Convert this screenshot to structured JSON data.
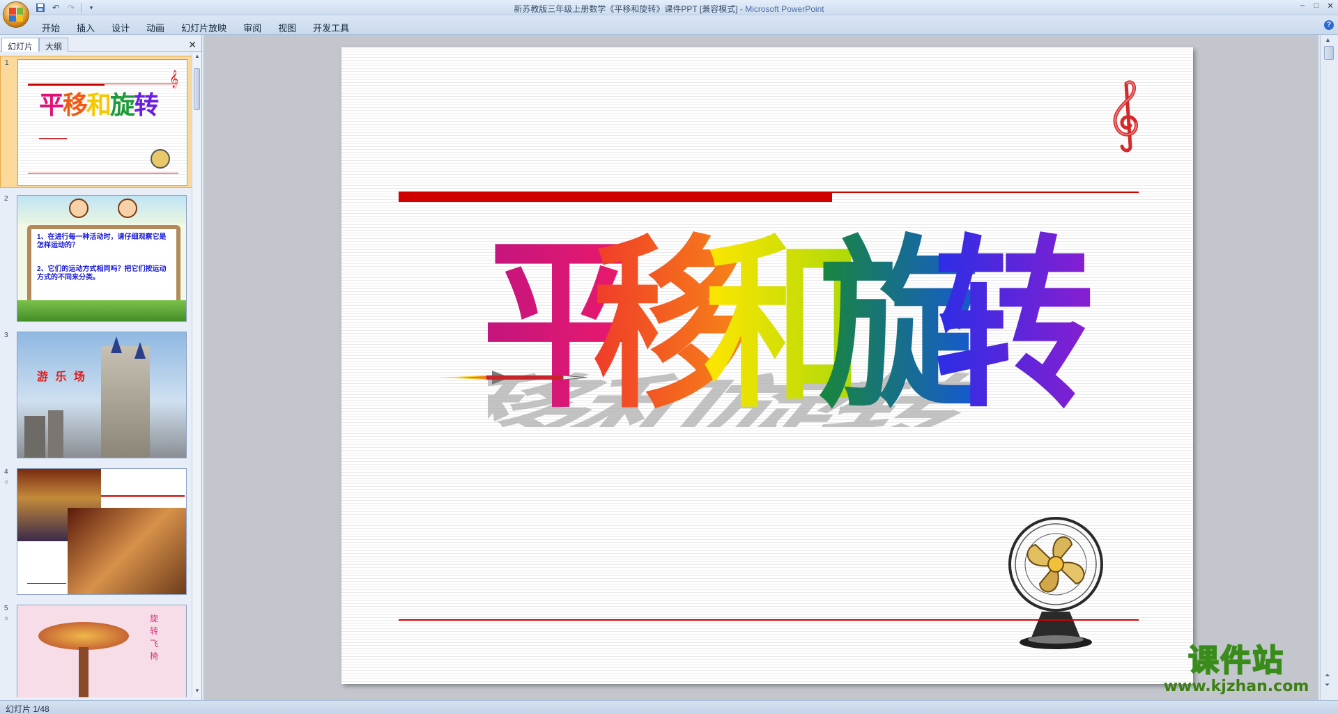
{
  "titlebar": {
    "title": "新苏教版三年级上册数学《平移和旋转》课件PPT [兼容模式] - ",
    "app_name": "Microsoft PowerPoint",
    "window_buttons": [
      "–",
      "□",
      "✕"
    ]
  },
  "quick_access": {
    "icons": [
      "save-icon",
      "undo-icon",
      "redo-icon",
      "customize-icon"
    ]
  },
  "ribbon": {
    "tabs": [
      "开始",
      "插入",
      "设计",
      "动画",
      "幻灯片放映",
      "审阅",
      "视图",
      "开发工具"
    ],
    "help_label": "?"
  },
  "slides_pane": {
    "tab_slides": "幻灯片",
    "tab_outline": "大纲",
    "close_label": "✕",
    "thumbnails": [
      {
        "num": "1",
        "title": "平移和旋转"
      },
      {
        "num": "2",
        "text1": "1、在进行每一种活动时，请仔细观察它是怎样运动的？",
        "text2": "2、它们的运动方式相同吗？把它们按运动方式的不同来分类。"
      },
      {
        "num": "3",
        "title": "游 乐 场"
      },
      {
        "num": "4"
      },
      {
        "num": "5",
        "title": "旋转飞椅"
      }
    ]
  },
  "slide": {
    "title_chars": [
      "平",
      "移",
      "和",
      "旋",
      "转"
    ],
    "char_colors": [
      "#e0127a",
      "#f25a12",
      "#f5e600",
      "#1f9a3a",
      "#6a1ee0"
    ]
  },
  "watermark": {
    "line1": "课件站",
    "line2": "www.kjzhan.com"
  },
  "status": {
    "slide_info": "幻灯片 1/48"
  }
}
